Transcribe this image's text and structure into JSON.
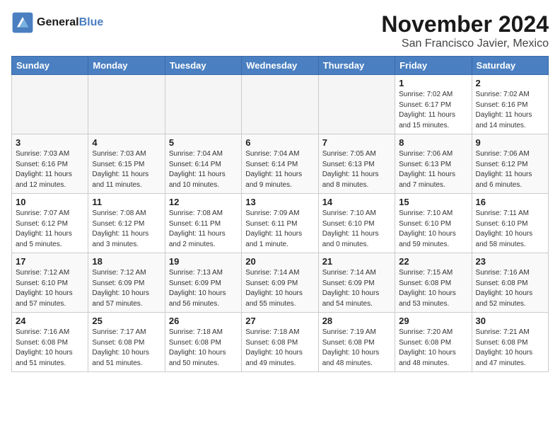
{
  "logo": {
    "line1": "General",
    "line2": "Blue"
  },
  "title": "November 2024",
  "location": "San Francisco Javier, Mexico",
  "weekdays": [
    "Sunday",
    "Monday",
    "Tuesday",
    "Wednesday",
    "Thursday",
    "Friday",
    "Saturday"
  ],
  "weeks": [
    [
      {
        "day": "",
        "info": ""
      },
      {
        "day": "",
        "info": ""
      },
      {
        "day": "",
        "info": ""
      },
      {
        "day": "",
        "info": ""
      },
      {
        "day": "",
        "info": ""
      },
      {
        "day": "1",
        "info": "Sunrise: 7:02 AM\nSunset: 6:17 PM\nDaylight: 11 hours and 15 minutes."
      },
      {
        "day": "2",
        "info": "Sunrise: 7:02 AM\nSunset: 6:16 PM\nDaylight: 11 hours and 14 minutes."
      }
    ],
    [
      {
        "day": "3",
        "info": "Sunrise: 7:03 AM\nSunset: 6:16 PM\nDaylight: 11 hours and 12 minutes."
      },
      {
        "day": "4",
        "info": "Sunrise: 7:03 AM\nSunset: 6:15 PM\nDaylight: 11 hours and 11 minutes."
      },
      {
        "day": "5",
        "info": "Sunrise: 7:04 AM\nSunset: 6:14 PM\nDaylight: 11 hours and 10 minutes."
      },
      {
        "day": "6",
        "info": "Sunrise: 7:04 AM\nSunset: 6:14 PM\nDaylight: 11 hours and 9 minutes."
      },
      {
        "day": "7",
        "info": "Sunrise: 7:05 AM\nSunset: 6:13 PM\nDaylight: 11 hours and 8 minutes."
      },
      {
        "day": "8",
        "info": "Sunrise: 7:06 AM\nSunset: 6:13 PM\nDaylight: 11 hours and 7 minutes."
      },
      {
        "day": "9",
        "info": "Sunrise: 7:06 AM\nSunset: 6:12 PM\nDaylight: 11 hours and 6 minutes."
      }
    ],
    [
      {
        "day": "10",
        "info": "Sunrise: 7:07 AM\nSunset: 6:12 PM\nDaylight: 11 hours and 5 minutes."
      },
      {
        "day": "11",
        "info": "Sunrise: 7:08 AM\nSunset: 6:12 PM\nDaylight: 11 hours and 3 minutes."
      },
      {
        "day": "12",
        "info": "Sunrise: 7:08 AM\nSunset: 6:11 PM\nDaylight: 11 hours and 2 minutes."
      },
      {
        "day": "13",
        "info": "Sunrise: 7:09 AM\nSunset: 6:11 PM\nDaylight: 11 hours and 1 minute."
      },
      {
        "day": "14",
        "info": "Sunrise: 7:10 AM\nSunset: 6:10 PM\nDaylight: 11 hours and 0 minutes."
      },
      {
        "day": "15",
        "info": "Sunrise: 7:10 AM\nSunset: 6:10 PM\nDaylight: 10 hours and 59 minutes."
      },
      {
        "day": "16",
        "info": "Sunrise: 7:11 AM\nSunset: 6:10 PM\nDaylight: 10 hours and 58 minutes."
      }
    ],
    [
      {
        "day": "17",
        "info": "Sunrise: 7:12 AM\nSunset: 6:10 PM\nDaylight: 10 hours and 57 minutes."
      },
      {
        "day": "18",
        "info": "Sunrise: 7:12 AM\nSunset: 6:09 PM\nDaylight: 10 hours and 57 minutes."
      },
      {
        "day": "19",
        "info": "Sunrise: 7:13 AM\nSunset: 6:09 PM\nDaylight: 10 hours and 56 minutes."
      },
      {
        "day": "20",
        "info": "Sunrise: 7:14 AM\nSunset: 6:09 PM\nDaylight: 10 hours and 55 minutes."
      },
      {
        "day": "21",
        "info": "Sunrise: 7:14 AM\nSunset: 6:09 PM\nDaylight: 10 hours and 54 minutes."
      },
      {
        "day": "22",
        "info": "Sunrise: 7:15 AM\nSunset: 6:08 PM\nDaylight: 10 hours and 53 minutes."
      },
      {
        "day": "23",
        "info": "Sunrise: 7:16 AM\nSunset: 6:08 PM\nDaylight: 10 hours and 52 minutes."
      }
    ],
    [
      {
        "day": "24",
        "info": "Sunrise: 7:16 AM\nSunset: 6:08 PM\nDaylight: 10 hours and 51 minutes."
      },
      {
        "day": "25",
        "info": "Sunrise: 7:17 AM\nSunset: 6:08 PM\nDaylight: 10 hours and 51 minutes."
      },
      {
        "day": "26",
        "info": "Sunrise: 7:18 AM\nSunset: 6:08 PM\nDaylight: 10 hours and 50 minutes."
      },
      {
        "day": "27",
        "info": "Sunrise: 7:18 AM\nSunset: 6:08 PM\nDaylight: 10 hours and 49 minutes."
      },
      {
        "day": "28",
        "info": "Sunrise: 7:19 AM\nSunset: 6:08 PM\nDaylight: 10 hours and 48 minutes."
      },
      {
        "day": "29",
        "info": "Sunrise: 7:20 AM\nSunset: 6:08 PM\nDaylight: 10 hours and 48 minutes."
      },
      {
        "day": "30",
        "info": "Sunrise: 7:21 AM\nSunset: 6:08 PM\nDaylight: 10 hours and 47 minutes."
      }
    ]
  ]
}
